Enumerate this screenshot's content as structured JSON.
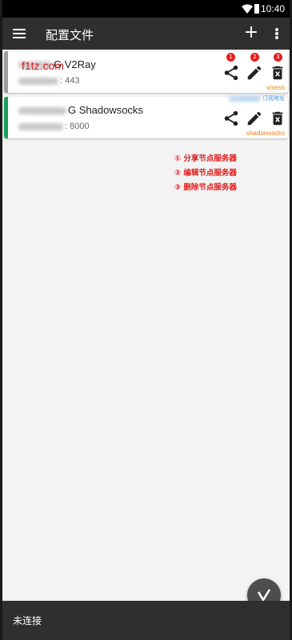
{
  "status_bar": {
    "time": "10:40"
  },
  "app_bar": {
    "title": "配置文件",
    "add_icon": "plus-icon",
    "menu_icon": "hamburger-icon",
    "more_icon": "more-vert-icon"
  },
  "watermark": "f1tz.com",
  "colors": {
    "appbar": "#2f2f2f",
    "vmess_tag": "#e8821a",
    "ss_stripe": "#1aa05a",
    "annotation": "#e21a1a",
    "subscription": "#3d8fd6"
  },
  "servers": [
    {
      "name": "G V2Ray",
      "address": ": 443",
      "type": "vmess",
      "stripe_color": "#9e9e9e",
      "subscription": ""
    },
    {
      "name": "G Shadowsocks",
      "address": ": 8000",
      "type": "shadowsocks",
      "stripe_color": "#1aa05a",
      "subscription": "订阅地址"
    }
  ],
  "action_badges": [
    "1",
    "2",
    "3"
  ],
  "annotations": [
    "① 分享节点服务器",
    "② 编辑节点服务器",
    "③ 删除节点服务器"
  ],
  "bottom_bar": {
    "status": "未连接"
  }
}
